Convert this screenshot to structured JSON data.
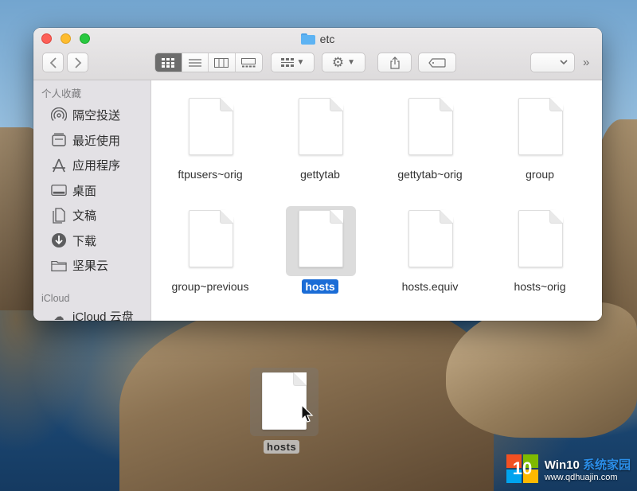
{
  "window": {
    "title": "etc"
  },
  "toolbar": {
    "back_icon": "chevron-left-icon",
    "forward_icon": "chevron-right-icon",
    "view_modes": [
      "icon-view-icon",
      "list-view-icon",
      "column-view-icon",
      "gallery-view-icon"
    ],
    "group_icon": "group-grid-icon",
    "action_icon": "gear-icon",
    "share_icon": "share-icon",
    "tag_icon": "tag-icon",
    "overflow_icon": "double-chevron-right-icon"
  },
  "sidebar": {
    "favorites_heading": "个人收藏",
    "items": [
      {
        "label": "隔空投送",
        "icon": "airdrop-icon"
      },
      {
        "label": "最近使用",
        "icon": "recents-icon"
      },
      {
        "label": "应用程序",
        "icon": "applications-icon"
      },
      {
        "label": "桌面",
        "icon": "desktop-icon"
      },
      {
        "label": "文稿",
        "icon": "documents-icon"
      },
      {
        "label": "下载",
        "icon": "downloads-icon"
      },
      {
        "label": "坚果云",
        "icon": "folder-icon"
      }
    ],
    "icloud_heading": "iCloud",
    "icloud_item": "iCloud 云盘"
  },
  "files": [
    {
      "name": "ftpusers~orig"
    },
    {
      "name": "gettytab"
    },
    {
      "name": "gettytab~orig"
    },
    {
      "name": "group"
    },
    {
      "name": "group~previous"
    },
    {
      "name": "hosts"
    },
    {
      "name": "hosts.equiv"
    },
    {
      "name": "hosts~orig"
    }
  ],
  "drag": {
    "label": "hosts"
  },
  "watermark": {
    "logo": "10",
    "title_a": "Win10 ",
    "title_b": "系统家园",
    "url": "www.qdhuajin.com"
  },
  "colors": {
    "selection": "#1a6cd6",
    "close": "#fd5f57",
    "minimize": "#febc2e",
    "maximize": "#28c840"
  }
}
